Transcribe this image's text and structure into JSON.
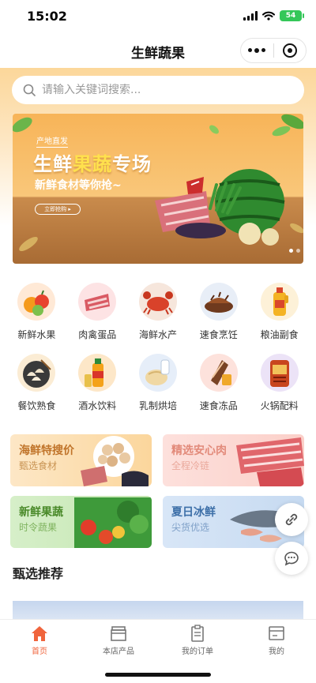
{
  "status": {
    "time": "15:02",
    "battery": "54"
  },
  "nav": {
    "title": "生鲜蔬果"
  },
  "search": {
    "placeholder": "请输入关键词搜索..."
  },
  "banner": {
    "origin": "产地直发",
    "title_a": "生鲜",
    "title_b": "果蔬",
    "title_c": "专场",
    "subtitle": "新鲜食材等你抢~",
    "cta": "立即抢购 ▸"
  },
  "categories": [
    {
      "label": "新鲜水果",
      "icon": "fruit-icon"
    },
    {
      "label": "肉禽蛋品",
      "icon": "meat-icon"
    },
    {
      "label": "海鲜水产",
      "icon": "crab-icon"
    },
    {
      "label": "速食烹饪",
      "icon": "cooked-meat-icon"
    },
    {
      "label": "粮油副食",
      "icon": "oil-bottle-icon"
    },
    {
      "label": "餐饮熟食",
      "icon": "dumpling-icon"
    },
    {
      "label": "酒水饮料",
      "icon": "drink-bottle-icon"
    },
    {
      "label": "乳制烘培",
      "icon": "bread-milk-icon"
    },
    {
      "label": "速食冻品",
      "icon": "frozen-food-icon"
    },
    {
      "label": "火锅配料",
      "icon": "hotpot-icon"
    }
  ],
  "promos": [
    {
      "title": "海鲜特搜价",
      "sub": "甄选食材",
      "color": "#c0742a"
    },
    {
      "title": "精选安心肉",
      "sub": "全程冷链",
      "color": "#e28a7a"
    },
    {
      "title": "新鲜果蔬",
      "sub": "时令蔬果",
      "color": "#4a8a2a"
    },
    {
      "title": "夏日冰鲜",
      "sub": "尖货优选",
      "color": "#3d6fa8"
    }
  ],
  "section": {
    "title": "甄选推荐"
  },
  "tabs": [
    {
      "label": "首页",
      "icon": "home-icon"
    },
    {
      "label": "本店产品",
      "icon": "store-icon"
    },
    {
      "label": "我的订单",
      "icon": "clipboard-icon"
    },
    {
      "label": "我的",
      "icon": "profile-card-icon"
    }
  ],
  "colors": {
    "accent": "#f0643c",
    "header_gradient": "#fcd79a"
  }
}
